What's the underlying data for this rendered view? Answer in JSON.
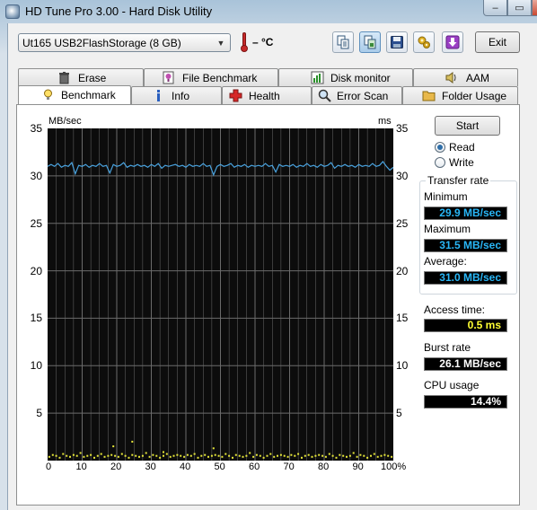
{
  "window": {
    "title": "HD Tune Pro 3.00 - Hard Disk Utility",
    "minimize_glyph": "–",
    "maximize_glyph": "▭",
    "close_glyph": "✕"
  },
  "toolbar": {
    "drive": "Ut165   USB2FlashStorage (8 GB)",
    "temperature": "– °C",
    "buttons": [
      {
        "name": "copy-text",
        "icon": "copy-text-icon"
      },
      {
        "name": "copy-screenshot",
        "icon": "copy-screenshot-icon"
      },
      {
        "name": "save-screenshot",
        "icon": "save-icon"
      },
      {
        "name": "options",
        "icon": "options-icon"
      },
      {
        "name": "download",
        "icon": "download-arrow-icon"
      }
    ],
    "exit_label": "Exit"
  },
  "tabs": {
    "top": [
      {
        "label": "Erase",
        "icon": "trash-icon"
      },
      {
        "label": "File Benchmark",
        "icon": "file-benchmark-icon"
      },
      {
        "label": "Disk monitor",
        "icon": "disk-monitor-icon"
      },
      {
        "label": "AAM",
        "icon": "speaker-icon"
      }
    ],
    "bottom": [
      {
        "label": "Benchmark",
        "icon": "lightbulb-icon",
        "selected": true
      },
      {
        "label": "Info",
        "icon": "info-icon"
      },
      {
        "label": "Health",
        "icon": "health-cross-icon"
      },
      {
        "label": "Error Scan",
        "icon": "magnifier-icon"
      },
      {
        "label": "Folder Usage",
        "icon": "folder-icon"
      }
    ]
  },
  "benchmark": {
    "start_label": "Start",
    "mode_options": [
      "Read",
      "Write"
    ],
    "selected_mode": "Read",
    "transfer_rate_title": "Transfer rate",
    "minimum_label": "Minimum",
    "minimum_value": "29.9 MB/sec",
    "maximum_label": "Maximum",
    "maximum_value": "31.5 MB/sec",
    "average_label": "Average:",
    "average_value": "31.0 MB/sec",
    "access_label": "Access time:",
    "access_value": "0.5 ms",
    "burst_label": "Burst rate",
    "burst_value": "26.1 MB/sec",
    "cpu_label": "CPU usage",
    "cpu_value": "14.4%"
  },
  "colors": {
    "transfer_line": "#4aa3df",
    "access_points": "#e8e83a",
    "plot_background": "#0c0c0c",
    "grid": "#6b6b6b"
  },
  "chart_data": {
    "type": "line",
    "y_left_unit": "MB/sec",
    "y_right_unit": "ms",
    "x_ticks": [
      "0",
      "10",
      "20",
      "30",
      "40",
      "50",
      "60",
      "70",
      "80",
      "90",
      "100%"
    ],
    "y_ticks": [
      "5",
      "10",
      "15",
      "20",
      "25",
      "30",
      "35"
    ],
    "ylim_left": [
      0,
      35
    ],
    "ylim_right": [
      0,
      35
    ],
    "xlim": [
      0,
      100
    ],
    "grid": true,
    "series": [
      {
        "kind": "transfer_rate",
        "x": [
          0,
          1,
          2,
          3,
          4,
          5,
          6,
          7,
          8,
          9,
          10,
          11,
          12,
          13,
          14,
          15,
          16,
          17,
          18,
          19,
          20,
          21,
          22,
          23,
          24,
          25,
          26,
          27,
          28,
          29,
          30,
          31,
          32,
          33,
          34,
          35,
          36,
          37,
          38,
          39,
          40,
          41,
          42,
          43,
          44,
          45,
          46,
          47,
          48,
          49,
          50,
          51,
          52,
          53,
          54,
          55,
          56,
          57,
          58,
          59,
          60,
          61,
          62,
          63,
          64,
          65,
          66,
          67,
          68,
          69,
          70,
          71,
          72,
          73,
          74,
          75,
          76,
          77,
          78,
          79,
          80,
          81,
          82,
          83,
          84,
          85,
          86,
          87,
          88,
          89,
          90,
          91,
          92,
          93,
          94,
          95,
          96,
          97,
          98,
          99,
          100
        ],
        "y": [
          31.0,
          31.2,
          31.0,
          31.3,
          30.9,
          31.1,
          31.0,
          31.4,
          30.2,
          31.1,
          31.0,
          31.2,
          30.9,
          31.1,
          31.0,
          31.3,
          31.0,
          31.1,
          30.3,
          31.2,
          31.0,
          31.1,
          31.4,
          30.9,
          31.1,
          31.0,
          31.2,
          31.0,
          31.1,
          30.9,
          31.2,
          31.0,
          31.3,
          30.8,
          31.1,
          31.0,
          31.1,
          31.2,
          31.0,
          31.1,
          30.9,
          31.2,
          31.0,
          31.1,
          31.0,
          31.3,
          31.0,
          31.1,
          30.1,
          31.0,
          31.2,
          31.0,
          31.1,
          31.3,
          30.9,
          31.1,
          31.0,
          31.2,
          30.9,
          31.1,
          31.0,
          31.1,
          31.0,
          31.3,
          31.0,
          31.1,
          30.4,
          31.2,
          31.0,
          31.1,
          31.0,
          31.2,
          30.9,
          31.1,
          31.0,
          31.3,
          31.0,
          31.1,
          30.9,
          31.2,
          31.0,
          31.1,
          31.4,
          30.8,
          31.1,
          31.0,
          31.2,
          31.0,
          31.1,
          30.9,
          31.2,
          31.0,
          31.1,
          31.0,
          31.3,
          31.0,
          31.1,
          31.5,
          31.0,
          30.6,
          30.9
        ]
      },
      {
        "kind": "access_time",
        "x": [
          0.5,
          1.5,
          2.5,
          3.5,
          4.5,
          5.5,
          6.5,
          7.5,
          8.5,
          9.5,
          10.5,
          11.5,
          12.5,
          13.5,
          14.5,
          15.5,
          16.5,
          17.5,
          18.5,
          19.5,
          20.5,
          21.5,
          22.5,
          23.5,
          24.5,
          25.5,
          26.5,
          27.5,
          28.5,
          29.5,
          30.5,
          31.5,
          32.5,
          33.5,
          34.5,
          35.5,
          36.5,
          37.5,
          38.5,
          39.5,
          40.5,
          41.5,
          42.5,
          43.5,
          44.5,
          45.5,
          46.5,
          47.5,
          48.5,
          49.5,
          50.5,
          51.5,
          52.5,
          53.5,
          54.5,
          55.5,
          56.5,
          57.5,
          58.5,
          59.5,
          60.5,
          61.5,
          62.5,
          63.5,
          64.5,
          65.5,
          66.5,
          67.5,
          68.5,
          69.5,
          70.5,
          71.5,
          72.5,
          73.5,
          74.5,
          75.5,
          76.5,
          77.5,
          78.5,
          79.5,
          80.5,
          81.5,
          82.5,
          83.5,
          84.5,
          85.5,
          86.5,
          87.5,
          88.5,
          89.5,
          90.5,
          91.5,
          92.5,
          93.5,
          94.5,
          95.5,
          96.5,
          97.5,
          98.5,
          99.5,
          19.0,
          24.5,
          48.0,
          33.5
        ],
        "y": [
          0.4,
          0.6,
          0.5,
          0.3,
          0.7,
          0.5,
          0.4,
          0.6,
          0.5,
          0.8,
          0.4,
          0.5,
          0.6,
          0.3,
          0.5,
          0.7,
          0.4,
          0.5,
          0.6,
          0.5,
          0.4,
          0.7,
          0.5,
          0.3,
          0.6,
          0.5,
          0.4,
          0.5,
          0.8,
          0.4,
          0.6,
          0.5,
          0.3,
          0.5,
          0.7,
          0.4,
          0.5,
          0.6,
          0.5,
          0.4,
          0.6,
          0.5,
          0.7,
          0.3,
          0.5,
          0.6,
          0.4,
          0.5,
          0.6,
          0.5,
          0.4,
          0.7,
          0.5,
          0.3,
          0.6,
          0.5,
          0.4,
          0.5,
          0.8,
          0.4,
          0.6,
          0.5,
          0.3,
          0.5,
          0.7,
          0.4,
          0.5,
          0.6,
          0.5,
          0.4,
          0.6,
          0.5,
          0.7,
          0.3,
          0.5,
          0.6,
          0.4,
          0.5,
          0.6,
          0.5,
          0.4,
          0.7,
          0.5,
          0.3,
          0.6,
          0.5,
          0.4,
          0.5,
          0.8,
          0.4,
          0.6,
          0.5,
          0.3,
          0.5,
          0.7,
          0.4,
          0.5,
          0.6,
          0.5,
          0.4,
          1.5,
          2.0,
          1.3,
          0.9
        ]
      }
    ]
  }
}
